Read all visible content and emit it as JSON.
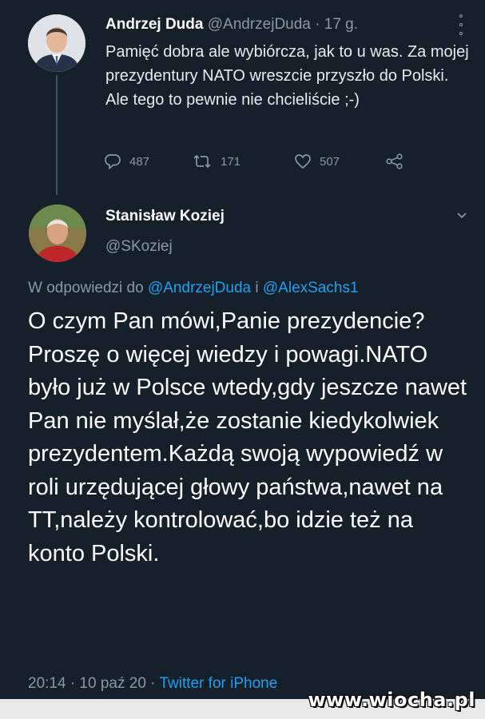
{
  "tweet1": {
    "name": "Andrzej Duda",
    "meta": " @AndrzejDuda · 17 g.",
    "text": "Pamięć dobra ale wybiórcza, jak to u was. Za mojej prezydentury NATO wreszcie przyszło do Polski. Ale tego to pewnie nie chcieliście ;-)",
    "replies": "487",
    "retweets": "171",
    "likes": "507"
  },
  "tweet2": {
    "name": "Stanisław Koziej",
    "handle": "@SKoziej",
    "replying_prefix": "W odpowiedzi do ",
    "replying_to_1": "@AndrzejDuda",
    "replying_joiner": " i ",
    "replying_to_2": "@AlexSachs1",
    "text": "O czym Pan mówi,Panie prezydencie?Proszę o więcej wiedzy i powagi.NATO było już w Polsce wtedy,gdy jeszcze nawet Pan nie myślał,że zostanie kiedykolwiek prezydentem.Każdą swoją wypowiedź w roli urzędującej głowy państwa,nawet na TT,należy kontrolować,bo idzie też na konto Polski.",
    "time": "20:14 · 10 paź 20 · ",
    "source": "Twitter for iPhone"
  },
  "watermark": "www.wiocha.pl",
  "colors": {
    "background": "#15202b",
    "secondary_text": "#8899a6",
    "link": "#1da1f2"
  }
}
